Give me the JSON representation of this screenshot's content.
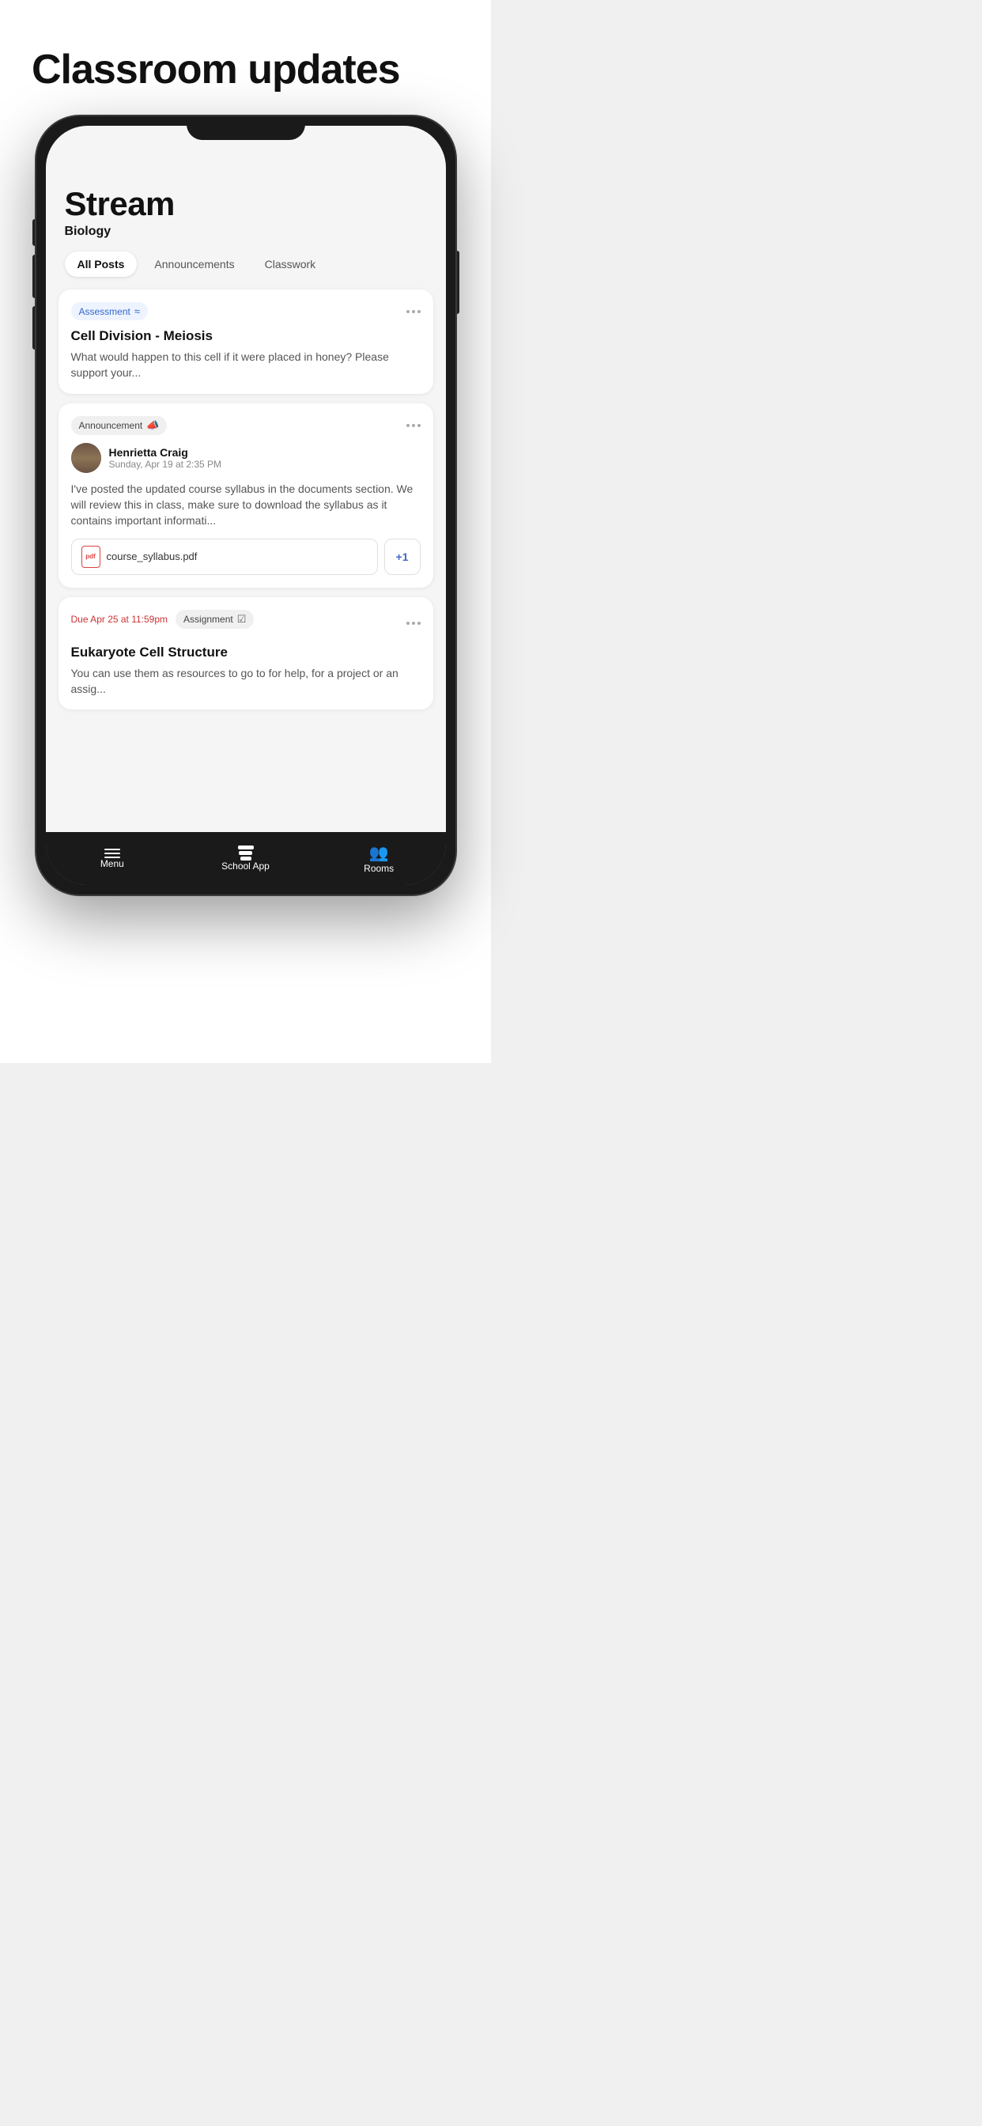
{
  "page": {
    "title": "Classroom updates",
    "background": "#ffffff"
  },
  "phone": {
    "screen": {
      "stream_title": "Stream",
      "stream_subtitle": "Biology",
      "tabs": [
        {
          "label": "All Posts",
          "active": true
        },
        {
          "label": "Announcements",
          "active": false
        },
        {
          "label": "Classwork",
          "active": false
        }
      ],
      "cards": [
        {
          "type": "assessment",
          "tag": "Assessment",
          "title": "Cell Division - Meiosis",
          "body": "What would happen to this cell if it were placed in honey? Please support your..."
        },
        {
          "type": "announcement",
          "tag": "Announcement",
          "author_name": "Henrietta Craig",
          "author_date": "Sunday, Apr 19 at 2:35 PM",
          "body": "I've posted the updated course syllabus in the documents section. We will review this in class, make sure to download the syllabus as it contains important informati...",
          "attachment": "course_syllabus.pdf",
          "extra_count": "+1"
        },
        {
          "type": "assignment",
          "due_label": "Due Apr 25 at 11:59pm",
          "tag": "Assignment",
          "title": "Eukaryote Cell Structure",
          "body": "You can use them as resources to go to for help, for a project or an assig..."
        }
      ]
    },
    "bottom_nav": [
      {
        "label": "Menu",
        "icon": "menu"
      },
      {
        "label": "School App",
        "icon": "stack"
      },
      {
        "label": "Rooms",
        "icon": "rooms"
      }
    ]
  }
}
